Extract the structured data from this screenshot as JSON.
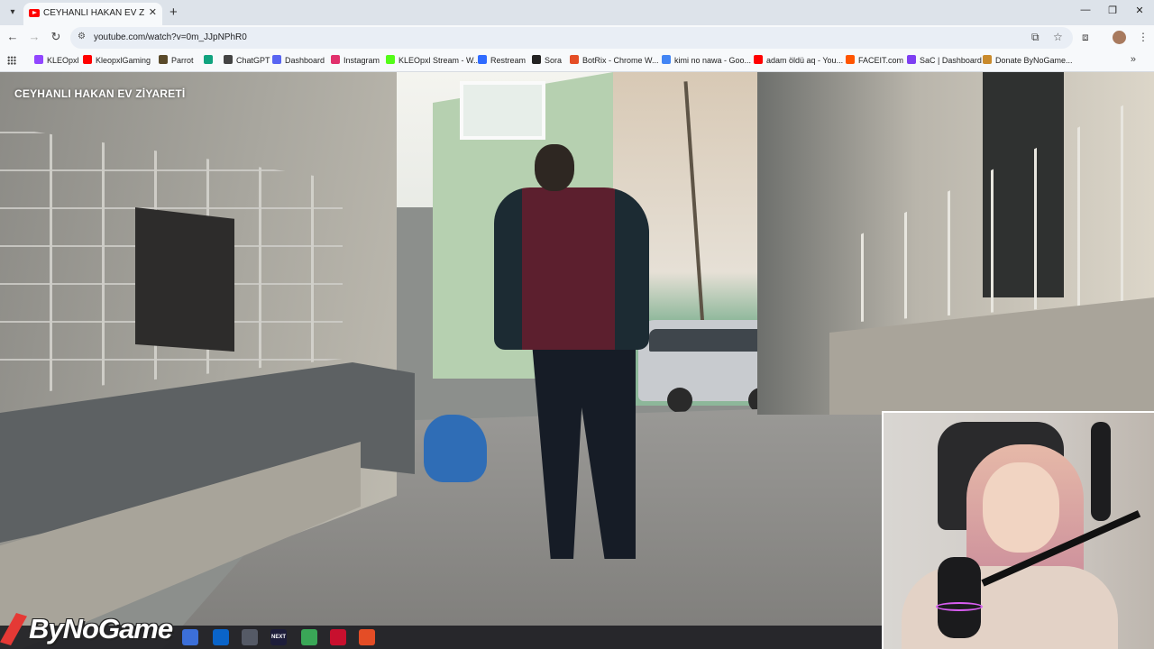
{
  "browser": {
    "tab": {
      "title": "CEYHANLI HAKAN EV ZİYARETİ",
      "close": "✕"
    },
    "new_tab": "+",
    "window_controls": {
      "minimize": "—",
      "restore": "❐",
      "close": "✕"
    },
    "nav": {
      "back": "←",
      "forward": "→",
      "reload": "↻"
    },
    "address": {
      "url": "youtube.com/watch?v=0m_JJpNPhR0"
    },
    "bookmarks": [
      {
        "label": "KLEOpxl",
        "color": "#9146ff"
      },
      {
        "label": "KleopxlGaming",
        "color": "#ff0000"
      },
      {
        "label": "Parrot",
        "color": "#5a4a2a"
      },
      {
        "label": "",
        "color": "#10a37f"
      },
      {
        "label": "ChatGPT",
        "color": "#444444"
      },
      {
        "label": "Dashboard",
        "color": "#5865f2"
      },
      {
        "label": "Instagram",
        "color": "#e1306c"
      },
      {
        "label": "KLEOpxl Stream - W...",
        "color": "#53fc18"
      },
      {
        "label": "Restream",
        "color": "#2f6bff"
      },
      {
        "label": "Sora",
        "color": "#222222"
      },
      {
        "label": "BotRix - Chrome W...",
        "color": "#e44d26"
      },
      {
        "label": "kimi no nawa - Goo...",
        "color": "#4285f4"
      },
      {
        "label": "adam öldü aq - You...",
        "color": "#ff0000"
      },
      {
        "label": "FACEIT.com",
        "color": "#ff5500"
      },
      {
        "label": "SaC | Dashboard",
        "color": "#7e3ff2"
      },
      {
        "label": "Donate ByNoGame...",
        "color": "#c98a2c"
      }
    ]
  },
  "video": {
    "title": "CEYHANLI HAKAN EV ZİYARETİ"
  },
  "overlay": {
    "logo": "ByNoGame",
    "taskbar_apps": [
      "",
      "",
      "",
      "NEXT",
      "",
      "",
      ""
    ]
  }
}
